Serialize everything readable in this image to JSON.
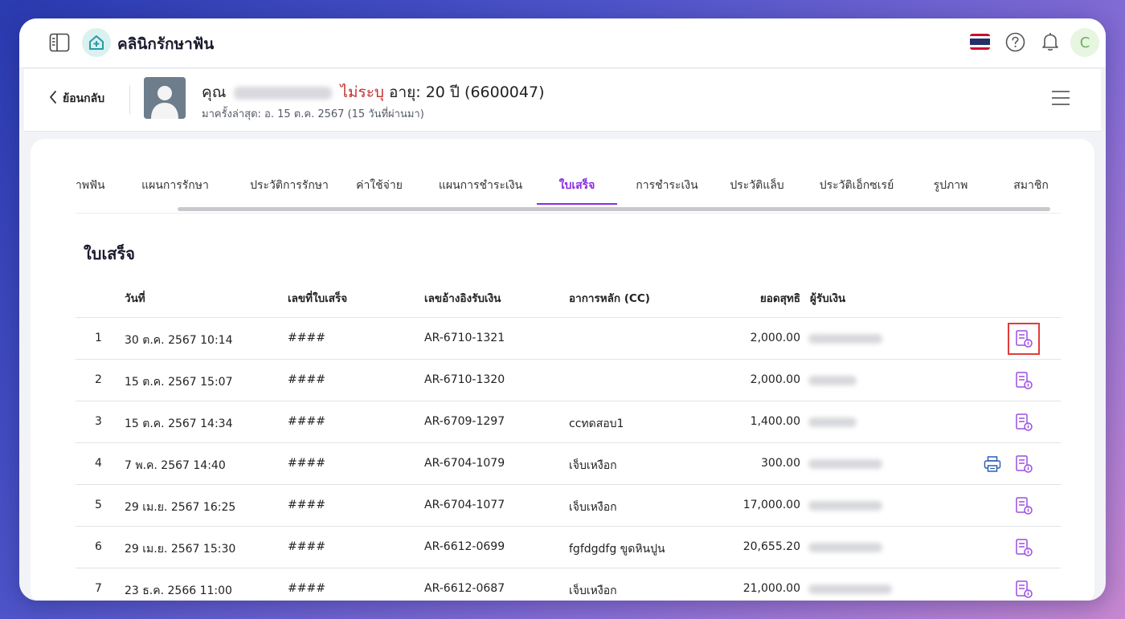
{
  "app": {
    "title": "คลินิกรักษาฟัน",
    "user_initial": "C",
    "icons": {
      "sidebar": "sidebar-toggle-icon",
      "logo": "house-plus-icon",
      "flag": "thailand-flag-icon",
      "help": "help-circle-icon",
      "bell": "bell-icon"
    }
  },
  "patient": {
    "back_label": "ย้อนกลับ",
    "prefix": "คุณ",
    "unspecified": "ไม่ระบุ",
    "age_label": "อายุ: 20 ปี",
    "id": "(6600047)",
    "last_visit": "มาครั้งล่าสุด: อ. 15 ต.ค. 2567 (15 วันที่ผ่านมา)"
  },
  "tabs": [
    {
      "label": "าพฟัน"
    },
    {
      "label": "แผนการรักษา"
    },
    {
      "label": "ประวัติการรักษา"
    },
    {
      "label": "ค่าใช้จ่าย"
    },
    {
      "label": "แผนการชำระเงิน"
    },
    {
      "label": "ใบเสร็จ",
      "active": true
    },
    {
      "label": "การชำระเงิน"
    },
    {
      "label": "ประวัติแล็บ"
    },
    {
      "label": "ประวัติเอ็กซเรย์"
    },
    {
      "label": "รูปภาพ"
    },
    {
      "label": "สมาชิก"
    }
  ],
  "receipts": {
    "title": "ใบเสร็จ",
    "columns": {
      "date": "วันที่",
      "receipt_no": "เลขที่ใบเสร็จ",
      "reference": "เลขอ้างอิงรับเงิน",
      "cc": "อาการหลัก (CC)",
      "net": "ยอดสุทธิ",
      "cashier": "ผู้รับเงิน"
    },
    "rows": [
      {
        "no": "1",
        "date": "30 ต.ค. 2567 10:14",
        "receipt_no": "####",
        "reference": "AR-6710-1321",
        "cc": "",
        "net": "2,000.00"
      },
      {
        "no": "2",
        "date": "15 ต.ค. 2567 15:07",
        "receipt_no": "####",
        "reference": "AR-6710-1320",
        "cc": "",
        "net": "2,000.00"
      },
      {
        "no": "3",
        "date": "15 ต.ค. 2567 14:34",
        "receipt_no": "####",
        "reference": "AR-6709-1297",
        "cc": "ccทดสอบ1",
        "net": "1,400.00"
      },
      {
        "no": "4",
        "date": "7 พ.ค. 2567 14:40",
        "receipt_no": "####",
        "reference": "AR-6704-1079",
        "cc": "เจ็บเหงือก",
        "net": "300.00"
      },
      {
        "no": "5",
        "date": "29 เม.ย. 2567 16:25",
        "receipt_no": "####",
        "reference": "AR-6704-1077",
        "cc": "เจ็บเหงือก",
        "net": "17,000.00"
      },
      {
        "no": "6",
        "date": "29 เม.ย. 2567 15:30",
        "receipt_no": "####",
        "reference": "AR-6612-0699",
        "cc": "fgfdgdfg ขูดหินปูน",
        "net": "20,655.20"
      },
      {
        "no": "7",
        "date": "23 ธ.ค. 2566 11:00",
        "receipt_no": "####",
        "reference": "AR-6612-0687",
        "cc": "เจ็บเหงือก",
        "net": "21,000.00"
      }
    ]
  },
  "colors": {
    "accent": "#8a2be2",
    "unspecified": "#c23030",
    "highlight": "#e23b3b",
    "print": "#2f5fb3"
  }
}
